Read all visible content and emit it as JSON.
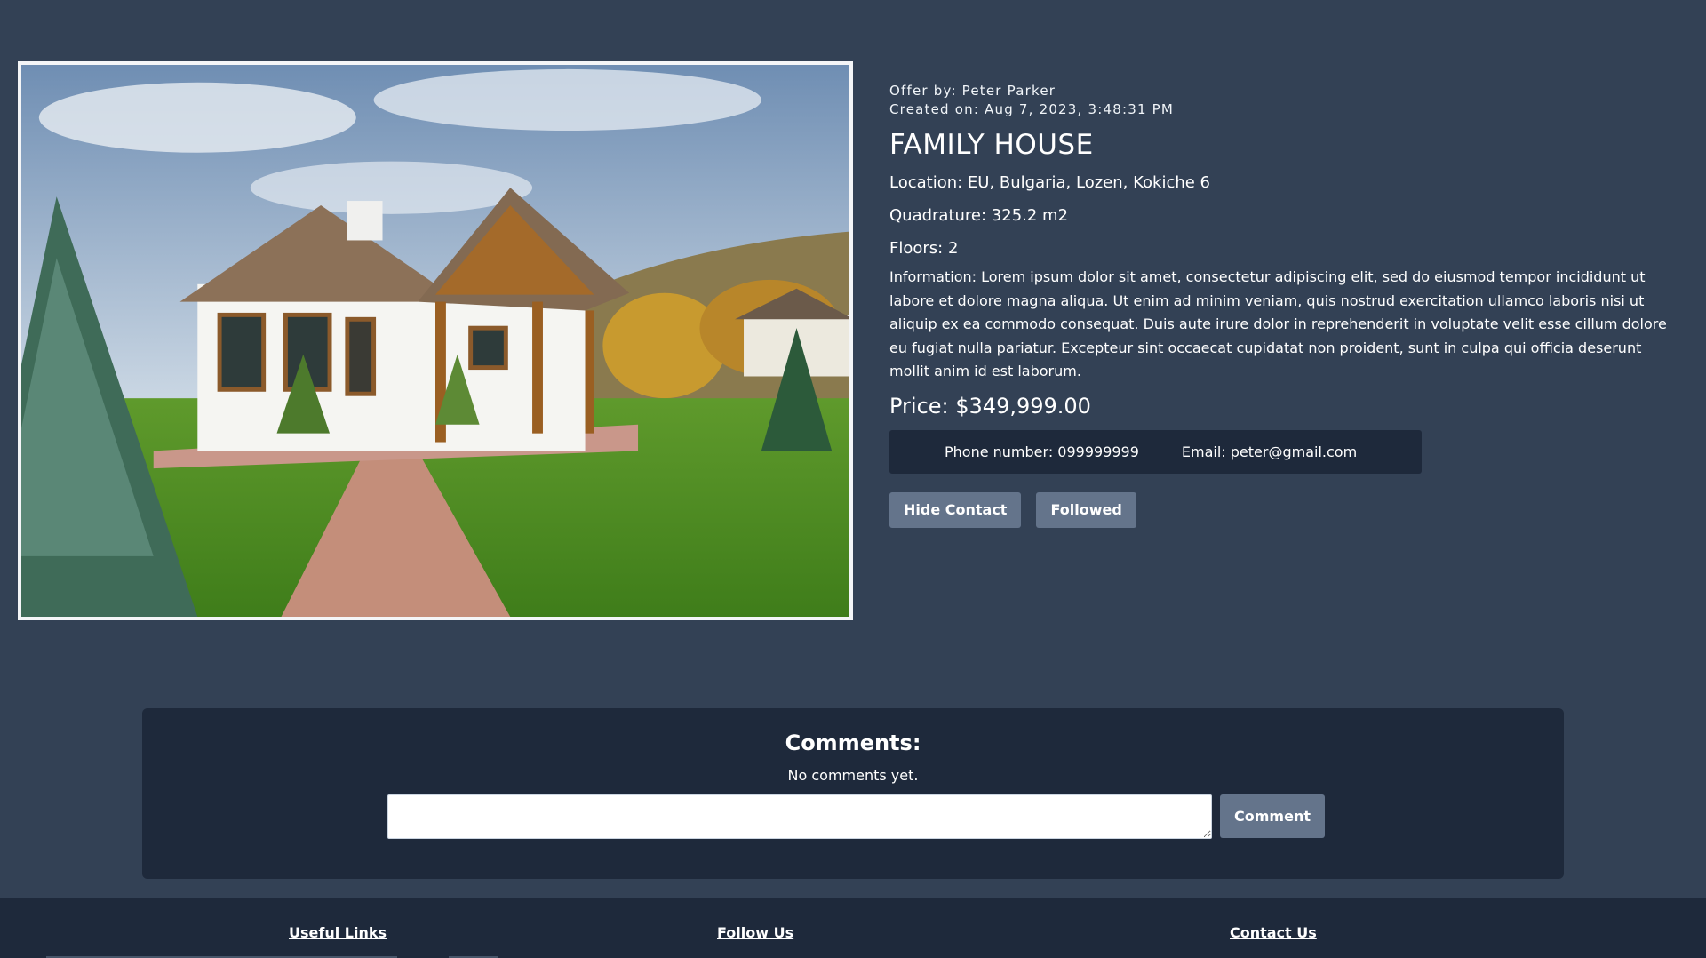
{
  "offer": {
    "offered_by": "Offer by: Peter Parker",
    "created_on": "Created on: Aug 7, 2023, 3:48:31 PM",
    "title": "FAMILY HOUSE",
    "location": "Location: EU, Bulgaria, Lozen, Kokiche 6",
    "quadrature": "Quadrature: 325.2 m2",
    "floors": "Floors: 2",
    "information": "Information: Lorem ipsum dolor sit amet, consectetur adipiscing elit, sed do eiusmod tempor incididunt ut labore et dolore magna aliqua. Ut enim ad minim veniam, quis nostrud exercitation ullamco laboris nisi ut aliquip ex ea commodo consequat. Duis aute irure dolor in reprehenderit in voluptate velit esse cillum dolore eu fugiat nulla pariatur. Excepteur sint occaecat cupidatat non proident, sunt in culpa qui officia deserunt mollit anim id est laborum.",
    "price": "Price: $349,999.00",
    "image_subject": "house-photo"
  },
  "contact": {
    "phone": "Phone number: 099999999",
    "email": "Email: peter@gmail.com"
  },
  "actions": {
    "hide_contact_label": "Hide Contact",
    "followed_label": "Followed"
  },
  "comments": {
    "title": "Comments:",
    "empty_text": "No comments yet.",
    "input_value": "",
    "submit_label": "Comment"
  },
  "footer": {
    "useful_links": "Useful Links",
    "follow_us": "Follow Us",
    "contact_us": "Contact Us"
  },
  "colors": {
    "page_background": "#334155",
    "panel_background": "#1e293b",
    "button_background": "#64748b",
    "text": "#ffffff"
  }
}
